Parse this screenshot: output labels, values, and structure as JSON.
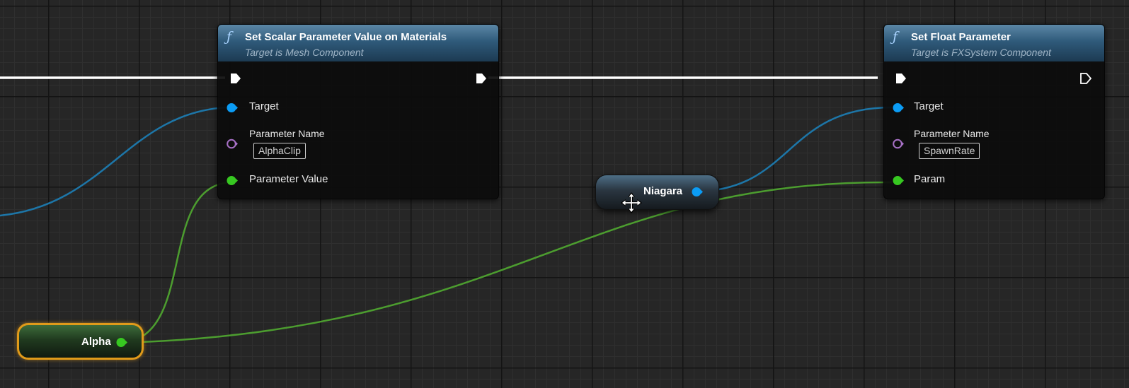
{
  "colors": {
    "exec": "#ffffff",
    "object_pin": "#0b9cf5",
    "name_pin": "#a871c7",
    "float_pin": "#37c821",
    "object_wire": "#1d76a8",
    "float_wire": "#4c9d2f",
    "selection": "#e09a1a",
    "header": "#2f5a7a"
  },
  "nodes": {
    "set_scalar": {
      "icon": "function-icon",
      "title": "Set Scalar Parameter Value on Materials",
      "subtitle": "Target is Mesh Component",
      "target_label": "Target",
      "param_name_label": "Parameter Name",
      "param_name_value": "AlphaClip",
      "param_value_label": "Parameter Value"
    },
    "set_float": {
      "icon": "function-icon",
      "title": "Set Float Parameter",
      "subtitle": "Target is FXSystem Component",
      "target_label": "Target",
      "param_name_label": "Parameter Name",
      "param_name_value": "SpawnRate",
      "param_label": "Param"
    },
    "niagara_var": {
      "label": "Niagara"
    },
    "alpha_var": {
      "label": "Alpha",
      "selected": true
    }
  },
  "cursor": {
    "icon": "move-cursor-icon"
  }
}
